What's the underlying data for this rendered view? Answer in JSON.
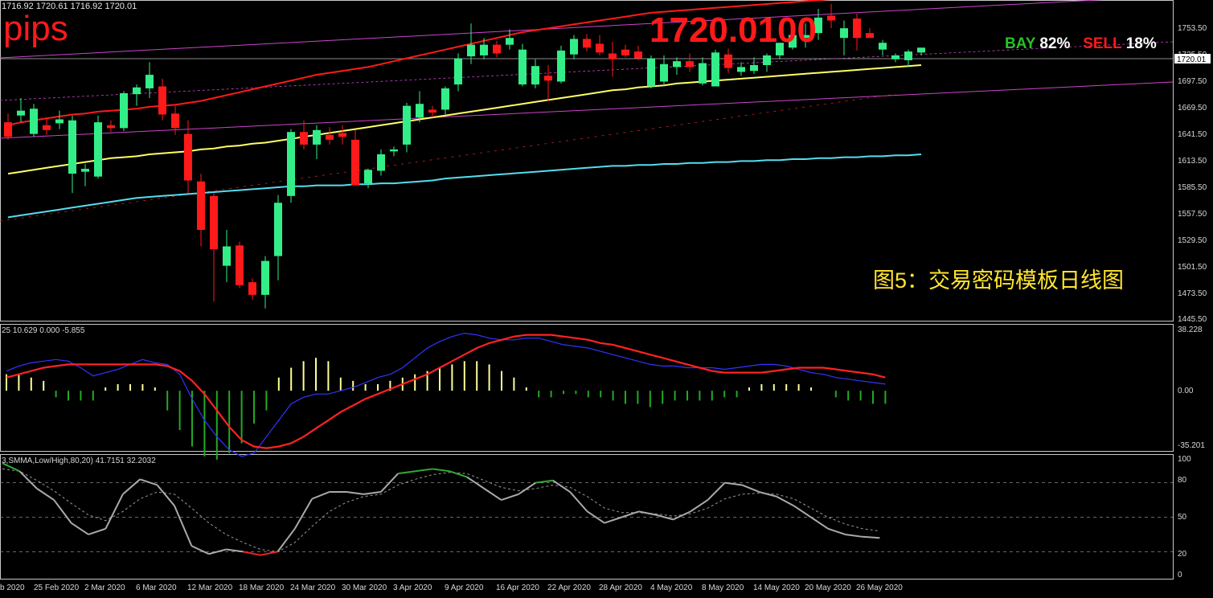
{
  "header": {
    "ohlc": "1716.92 1720.61 1716.92 1720.01",
    "pips": "pips",
    "big_price": "1720.0100",
    "bay_label": "BAY",
    "bay_pct": "82%",
    "sell_label": "SELL",
    "sell_pct": "18%",
    "caption": "图5：交易密码模板日线图"
  },
  "price_axis": {
    "labels": [
      "1753.50",
      "1725.50",
      "1697.50",
      "1669.50",
      "1641.50",
      "1613.50",
      "1585.50",
      "1557.50",
      "1529.50",
      "1501.50",
      "1473.50",
      "1445.50"
    ],
    "current": "1720.01"
  },
  "macd": {
    "info": "25 10.629 0.000 -5.855",
    "labels": [
      "38.228",
      "0.00",
      "-35.201"
    ]
  },
  "stoch": {
    "info": "3,SMMA,Low/High,80,20) 41.7151 32.2032",
    "labels": [
      "100",
      "80",
      "50",
      "20",
      "0"
    ]
  },
  "time_axis": [
    "b 2020",
    "25 Feb 2020",
    "2 Mar 2020",
    "6 Mar 2020",
    "12 Mar 2020",
    "18 Mar 2020",
    "24 Mar 2020",
    "30 Mar 2020",
    "3 Apr 2020",
    "9 Apr 2020",
    "16 Apr 2020",
    "22 Apr 2020",
    "28 Apr 2020",
    "4 May 2020",
    "8 May 2020",
    "14 May 2020",
    "20 May 2020",
    "26 May 2020"
  ],
  "colors": {
    "bull": "#33ee88",
    "bear": "#ff1a1a",
    "ma_red": "#ff1a1a",
    "ma_yellow": "#ffff66",
    "ma_cyan": "#55ddee",
    "channel": "#cc44cc",
    "macd_red": "#ff2222",
    "macd_blue": "#3333ff",
    "hist_pos": "#ffff99",
    "hist_neg": "#22aa22",
    "stoch_main": "#aaaaaa",
    "stoch_green": "#33aa33",
    "stoch_red": "#ee2222"
  },
  "chart_data": {
    "type": "candlestick",
    "title": "",
    "candles": [
      {
        "o": 1643,
        "h": 1652,
        "l": 1625,
        "c": 1628
      },
      {
        "o": 1650,
        "h": 1668,
        "l": 1643,
        "c": 1655
      },
      {
        "o": 1631,
        "h": 1662,
        "l": 1628,
        "c": 1657
      },
      {
        "o": 1640,
        "h": 1648,
        "l": 1630,
        "c": 1635
      },
      {
        "o": 1642,
        "h": 1655,
        "l": 1636,
        "c": 1646
      },
      {
        "o": 1590,
        "h": 1650,
        "l": 1570,
        "c": 1645
      },
      {
        "o": 1592,
        "h": 1600,
        "l": 1577,
        "c": 1595
      },
      {
        "o": 1587,
        "h": 1650,
        "l": 1585,
        "c": 1643
      },
      {
        "o": 1640,
        "h": 1645,
        "l": 1633,
        "c": 1637
      },
      {
        "o": 1637,
        "h": 1675,
        "l": 1634,
        "c": 1673
      },
      {
        "o": 1672,
        "h": 1682,
        "l": 1660,
        "c": 1679
      },
      {
        "o": 1678,
        "h": 1705,
        "l": 1668,
        "c": 1692
      },
      {
        "o": 1680,
        "h": 1688,
        "l": 1645,
        "c": 1651
      },
      {
        "o": 1652,
        "h": 1660,
        "l": 1630,
        "c": 1637
      },
      {
        "o": 1631,
        "h": 1645,
        "l": 1570,
        "c": 1583
      },
      {
        "o": 1582,
        "h": 1590,
        "l": 1515,
        "c": 1532
      },
      {
        "o": 1567,
        "h": 1570,
        "l": 1458,
        "c": 1512
      },
      {
        "o": 1495,
        "h": 1532,
        "l": 1478,
        "c": 1515
      },
      {
        "o": 1516,
        "h": 1520,
        "l": 1472,
        "c": 1475
      },
      {
        "o": 1478,
        "h": 1482,
        "l": 1460,
        "c": 1465
      },
      {
        "o": 1465,
        "h": 1505,
        "l": 1451,
        "c": 1500
      },
      {
        "o": 1505,
        "h": 1568,
        "l": 1480,
        "c": 1560
      },
      {
        "o": 1567,
        "h": 1636,
        "l": 1560,
        "c": 1633
      },
      {
        "o": 1633,
        "h": 1645,
        "l": 1615,
        "c": 1620
      },
      {
        "o": 1620,
        "h": 1640,
        "l": 1605,
        "c": 1635
      },
      {
        "o": 1630,
        "h": 1638,
        "l": 1620,
        "c": 1625
      },
      {
        "o": 1632,
        "h": 1640,
        "l": 1620,
        "c": 1628
      },
      {
        "o": 1625,
        "h": 1635,
        "l": 1578,
        "c": 1578
      },
      {
        "o": 1580,
        "h": 1595,
        "l": 1575,
        "c": 1594
      },
      {
        "o": 1593,
        "h": 1615,
        "l": 1588,
        "c": 1610
      },
      {
        "o": 1613,
        "h": 1618,
        "l": 1608,
        "c": 1615
      },
      {
        "o": 1620,
        "h": 1663,
        "l": 1612,
        "c": 1660
      },
      {
        "o": 1648,
        "h": 1675,
        "l": 1643,
        "c": 1662
      },
      {
        "o": 1656,
        "h": 1660,
        "l": 1648,
        "c": 1653
      },
      {
        "o": 1656,
        "h": 1680,
        "l": 1651,
        "c": 1678
      },
      {
        "o": 1682,
        "h": 1714,
        "l": 1675,
        "c": 1709
      },
      {
        "o": 1711,
        "h": 1745,
        "l": 1703,
        "c": 1723
      },
      {
        "o": 1712,
        "h": 1730,
        "l": 1708,
        "c": 1723
      },
      {
        "o": 1723,
        "h": 1727,
        "l": 1710,
        "c": 1714
      },
      {
        "o": 1723,
        "h": 1739,
        "l": 1718,
        "c": 1730
      },
      {
        "o": 1682,
        "h": 1724,
        "l": 1680,
        "c": 1718
      },
      {
        "o": 1682,
        "h": 1708,
        "l": 1678,
        "c": 1701
      },
      {
        "o": 1691,
        "h": 1702,
        "l": 1665,
        "c": 1686
      },
      {
        "o": 1685,
        "h": 1722,
        "l": 1683,
        "c": 1717
      },
      {
        "o": 1713,
        "h": 1733,
        "l": 1708,
        "c": 1729
      },
      {
        "o": 1729,
        "h": 1734,
        "l": 1716,
        "c": 1720
      },
      {
        "o": 1724,
        "h": 1733,
        "l": 1712,
        "c": 1715
      },
      {
        "o": 1714,
        "h": 1726,
        "l": 1690,
        "c": 1708
      },
      {
        "o": 1718,
        "h": 1723,
        "l": 1710,
        "c": 1712
      },
      {
        "o": 1716,
        "h": 1722,
        "l": 1707,
        "c": 1709
      },
      {
        "o": 1680,
        "h": 1712,
        "l": 1678,
        "c": 1709
      },
      {
        "o": 1685,
        "h": 1712,
        "l": 1680,
        "c": 1703
      },
      {
        "o": 1700,
        "h": 1710,
        "l": 1692,
        "c": 1706
      },
      {
        "o": 1706,
        "h": 1714,
        "l": 1695,
        "c": 1700
      },
      {
        "o": 1683,
        "h": 1710,
        "l": 1681,
        "c": 1704
      },
      {
        "o": 1680,
        "h": 1718,
        "l": 1680,
        "c": 1715
      },
      {
        "o": 1713,
        "h": 1719,
        "l": 1694,
        "c": 1699
      },
      {
        "o": 1695,
        "h": 1705,
        "l": 1691,
        "c": 1700
      },
      {
        "o": 1696,
        "h": 1710,
        "l": 1693,
        "c": 1702
      },
      {
        "o": 1702,
        "h": 1714,
        "l": 1695,
        "c": 1712
      },
      {
        "o": 1712,
        "h": 1725,
        "l": 1708,
        "c": 1725
      },
      {
        "o": 1720,
        "h": 1745,
        "l": 1718,
        "c": 1733
      },
      {
        "o": 1730,
        "h": 1745,
        "l": 1720,
        "c": 1733
      },
      {
        "o": 1735,
        "h": 1760,
        "l": 1728,
        "c": 1751
      },
      {
        "o": 1753,
        "h": 1765,
        "l": 1740,
        "c": 1748
      },
      {
        "o": 1730,
        "h": 1748,
        "l": 1712,
        "c": 1740
      },
      {
        "o": 1750,
        "h": 1755,
        "l": 1717,
        "c": 1730
      },
      {
        "o": 1735,
        "h": 1740,
        "l": 1730,
        "c": 1730
      },
      {
        "o": 1718,
        "h": 1728,
        "l": 1712,
        "c": 1725
      },
      {
        "o": 1708,
        "h": 1714,
        "l": 1705,
        "c": 1712
      },
      {
        "o": 1707,
        "h": 1718,
        "l": 1700,
        "c": 1716
      },
      {
        "o": 1715,
        "h": 1720,
        "l": 1712,
        "c": 1720
      }
    ],
    "ma_red": [
      1640,
      1643,
      1645,
      1647,
      1649,
      1651,
      1652,
      1654,
      1655,
      1656,
      1657,
      1659,
      1660,
      1661,
      1663,
      1665,
      1668,
      1671,
      1674,
      1677,
      1680,
      1683,
      1686,
      1689,
      1692,
      1694,
      1696,
      1698,
      1700,
      1703,
      1706,
      1709,
      1712,
      1715,
      1718,
      1721,
      1724,
      1727,
      1730,
      1733,
      1736,
      1738,
      1740,
      1742,
      1744,
      1746,
      1748,
      1750,
      1752,
      1754,
      1756,
      1757,
      1758,
      1759,
      1760,
      1761,
      1762,
      1763,
      1764,
      1765,
      1766,
      1767,
      1768,
      1769,
      1770,
      1771,
      1772,
      1773,
      1774,
      1775,
      1776,
      1777
    ],
    "ma_yellow": [
      1590,
      1592,
      1594,
      1596,
      1598,
      1600,
      1602,
      1604,
      1606,
      1607,
      1608,
      1610,
      1611,
      1612,
      1613,
      1615,
      1616,
      1618,
      1619,
      1621,
      1622,
      1624,
      1626,
      1628,
      1630,
      1632,
      1634,
      1636,
      1638,
      1640,
      1642,
      1644,
      1646,
      1648,
      1650,
      1652,
      1654,
      1656,
      1658,
      1660,
      1662,
      1664,
      1666,
      1668,
      1670,
      1672,
      1674,
      1676,
      1677,
      1679,
      1680,
      1681,
      1683,
      1684,
      1685,
      1686,
      1687,
      1688,
      1689,
      1690,
      1691,
      1692,
      1693,
      1694,
      1695,
      1696,
      1697,
      1698,
      1699,
      1700,
      1701,
      1702
    ],
    "ma_cyan": [
      1545,
      1547,
      1549,
      1551,
      1553,
      1555,
      1557,
      1559,
      1561,
      1563,
      1565,
      1566,
      1567,
      1568,
      1569,
      1570,
      1571,
      1572,
      1573,
      1574,
      1575,
      1576,
      1577,
      1577,
      1578,
      1578,
      1578,
      1579,
      1579,
      1580,
      1580,
      1581,
      1582,
      1583,
      1585,
      1586,
      1587,
      1588,
      1589,
      1590,
      1591,
      1592,
      1593,
      1594,
      1595,
      1596,
      1597,
      1598,
      1598,
      1599,
      1599,
      1600,
      1600,
      1601,
      1601,
      1602,
      1602,
      1603,
      1603,
      1604,
      1604,
      1605,
      1605,
      1606,
      1606,
      1607,
      1607,
      1608,
      1608,
      1609,
      1609,
      1610
    ],
    "macd": {
      "signal": [
        8,
        10,
        12,
        14,
        15,
        16,
        16,
        16,
        16,
        16,
        16,
        16,
        16,
        15,
        12,
        6,
        -2,
        -12,
        -22,
        -30,
        -34,
        -35,
        -34,
        -32,
        -28,
        -23,
        -18,
        -13,
        -9,
        -5,
        -2,
        1,
        4,
        7,
        10,
        14,
        18,
        22,
        26,
        29,
        31,
        33,
        34,
        34,
        34,
        33,
        32,
        31,
        29,
        28,
        26,
        24,
        22,
        20,
        18,
        16,
        14,
        12,
        11,
        11,
        11,
        11,
        12,
        13,
        14,
        14,
        14,
        13,
        12,
        11,
        10,
        8
      ],
      "macd_line": [
        12,
        15,
        17,
        18,
        19,
        18,
        14,
        9,
        11,
        13,
        16,
        19,
        17,
        16,
        10,
        -5,
        -18,
        -28,
        -36,
        -40,
        -38,
        -28,
        -18,
        -8,
        -4,
        -2,
        -2,
        0,
        2,
        5,
        8,
        10,
        14,
        20,
        26,
        30,
        33,
        35,
        34,
        32,
        31,
        31,
        32,
        32,
        30,
        28,
        27,
        26,
        24,
        22,
        20,
        18,
        16,
        15,
        15,
        14,
        14,
        14,
        13,
        14,
        15,
        16,
        16,
        15,
        13,
        11,
        10,
        8,
        7,
        6,
        5,
        4
      ],
      "histogram": [
        10,
        10,
        8,
        6,
        -4,
        -6,
        -6,
        -6,
        2,
        4,
        4,
        4,
        2,
        -12,
        -24,
        -34,
        -40,
        -42,
        -38,
        -32,
        -20,
        -12,
        8,
        14,
        18,
        20,
        18,
        8,
        6,
        4,
        4,
        6,
        8,
        10,
        12,
        14,
        16,
        18,
        18,
        16,
        12,
        8,
        2,
        -4,
        -4,
        -2,
        -2,
        -4,
        -4,
        -6,
        -8,
        -8,
        -10,
        -8,
        -6,
        -6,
        -6,
        -6,
        -4,
        -4,
        2,
        4,
        4,
        4,
        4,
        2,
        0,
        -4,
        -6,
        -6,
        -8,
        -8
      ]
    },
    "stochastic": {
      "main": [
        97,
        90,
        75,
        65,
        45,
        35,
        40,
        70,
        83,
        78,
        60,
        25,
        18,
        22,
        20,
        17,
        20,
        40,
        66,
        72,
        72,
        70,
        72,
        88,
        90,
        92,
        90,
        85,
        75,
        65,
        70,
        80,
        82,
        72,
        55,
        45,
        50,
        55,
        52,
        48,
        55,
        65,
        80,
        78,
        72,
        68,
        60,
        50,
        40,
        35,
        33,
        32
      ],
      "signal": [
        92,
        90,
        82,
        73,
        62,
        52,
        47,
        55,
        66,
        72,
        70,
        58,
        45,
        35,
        28,
        22,
        20,
        28,
        42,
        55,
        63,
        68,
        70,
        78,
        83,
        87,
        89,
        88,
        82,
        76,
        73,
        75,
        78,
        76,
        68,
        58,
        54,
        54,
        53,
        51,
        53,
        58,
        66,
        70,
        71,
        70,
        66,
        58,
        50,
        44,
        40,
        38
      ],
      "levels": [
        80,
        50,
        20
      ]
    }
  }
}
